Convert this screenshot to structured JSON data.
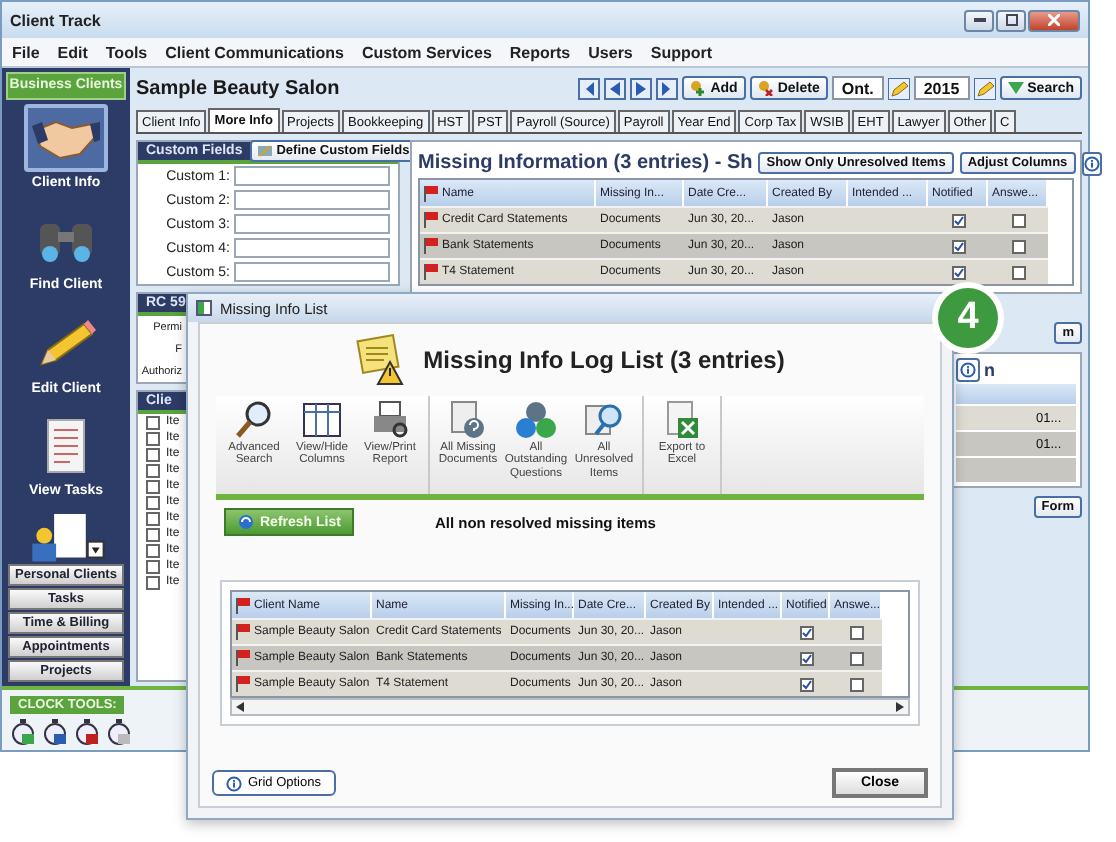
{
  "main_window": {
    "title": "Client Track",
    "menu": [
      "File",
      "Edit",
      "Tools",
      "Client Communications",
      "Custom Services",
      "Reports",
      "Users",
      "Support"
    ],
    "sidebar": {
      "header": "Business Clients",
      "tools": [
        {
          "label": "Client Info",
          "kind": "handshake",
          "selected": true
        },
        {
          "label": "Find Client",
          "kind": "binoculars",
          "selected": false
        },
        {
          "label": "Edit Client",
          "kind": "pencil",
          "selected": false
        },
        {
          "label": "View Tasks",
          "kind": "tasks",
          "selected": false
        }
      ],
      "nav": [
        "Personal Clients",
        "Tasks",
        "Time & Billing",
        "Appointments",
        "Projects"
      ]
    },
    "client_name": "Sample Beauty Salon",
    "toolbar": {
      "add": "Add",
      "delete": "Delete",
      "province": "Ont.",
      "year": "2015",
      "search": "Search"
    },
    "tabs": [
      {
        "label": "Client Info",
        "selected": false
      },
      {
        "label": "More Info",
        "selected": true
      },
      {
        "label": "Projects",
        "selected": false
      },
      {
        "label": "Bookkeeping",
        "selected": false
      },
      {
        "label": "HST",
        "selected": false
      },
      {
        "label": "PST",
        "selected": false
      },
      {
        "label": "Payroll (Source)",
        "selected": false
      },
      {
        "label": "Payroll",
        "selected": false
      },
      {
        "label": "Year End",
        "selected": false
      },
      {
        "label": "Corp Tax",
        "selected": false
      },
      {
        "label": "WSIB",
        "selected": false
      },
      {
        "label": "EHT",
        "selected": false
      },
      {
        "label": "Lawyer",
        "selected": false
      },
      {
        "label": "Other",
        "selected": false
      },
      {
        "label": "C",
        "selected": false
      }
    ],
    "custom_fields": {
      "title": "Custom Fields",
      "define_button": "Define Custom Fields",
      "fields": [
        "Custom 1:",
        "Custom 2:",
        "Custom 3:",
        "Custom 4:",
        "Custom 5:"
      ]
    },
    "rc59": {
      "title": "RC 59",
      "labels": [
        "Permi",
        "F",
        "Authoriz"
      ]
    },
    "client_section": {
      "title": "Clie",
      "items": [
        {
          "label": "Ite",
          "checked": false
        },
        {
          "label": "Ite",
          "checked": false
        },
        {
          "label": "Ite",
          "checked": false
        },
        {
          "label": "Ite",
          "checked": false
        },
        {
          "label": "Ite",
          "checked": false
        },
        {
          "label": "Ite",
          "checked": false
        },
        {
          "label": "Ite",
          "checked": false
        },
        {
          "label": "Ite",
          "checked": false
        },
        {
          "label": "Ite",
          "checked": false
        },
        {
          "label": "Ite",
          "checked": false
        },
        {
          "label": "Ite",
          "checked": false
        }
      ]
    },
    "missing_info": {
      "title": "Missing Information (3 entries) - Sh",
      "show_unresolved_button": "Show Only Unresolved Items",
      "adjust_columns_button": "Adjust Columns",
      "columns": [
        "Name",
        "Missing In...",
        "Date Cre...",
        "Created By",
        "Intended ...",
        "Notified",
        "Answe..."
      ],
      "rows": [
        {
          "name": "Credit Card Statements",
          "missing_in": "Documents",
          "date": "Jun 30, 20...",
          "created_by": "Jason",
          "notified": true,
          "answered": false
        },
        {
          "name": "Bank Statements",
          "missing_in": "Documents",
          "date": "Jun 30, 20...",
          "created_by": "Jason",
          "notified": true,
          "answered": false
        },
        {
          "name": "T4 Statement",
          "missing_in": "Documents",
          "date": "Jun 30, 20...",
          "created_by": "Jason",
          "notified": true,
          "answered": false
        }
      ]
    },
    "side_strip": {
      "top_button": "m",
      "section_title": "n",
      "cells": [
        "01...",
        "01..."
      ],
      "form_button": "Form"
    },
    "clock_tools": {
      "title": "CLOCK TOOLS:"
    }
  },
  "dialog": {
    "title": "Missing Info List",
    "heading": "Missing Info Log List (3 entries)",
    "tool_groups": [
      [
        {
          "label": "Advanced Search",
          "kind": "search"
        },
        {
          "label": "View/Hide Columns",
          "kind": "columns"
        },
        {
          "label": "View/Print Report",
          "kind": "report"
        }
      ],
      [
        {
          "label": "All Missing Documents",
          "kind": "documents"
        },
        {
          "label": "All Outstanding Questions",
          "kind": "questions"
        },
        {
          "label": "All Unresolved Items",
          "kind": "unresolved"
        }
      ],
      [
        {
          "label": "Export to Excel",
          "kind": "excel"
        }
      ]
    ],
    "refresh_button": "Refresh List",
    "filter_label": "All non resolved missing items",
    "columns": [
      "Client Name",
      "Name",
      "Missing In...",
      "Date Cre...",
      "Created By",
      "Intended ...",
      "Notified",
      "Answe..."
    ],
    "rows": [
      {
        "client": "Sample Beauty Salon",
        "name": "Credit Card Statements",
        "missing_in": "Documents",
        "date": "Jun 30, 20...",
        "created_by": "Jason",
        "notified": true,
        "answered": false
      },
      {
        "client": "Sample Beauty Salon",
        "name": "Bank Statements",
        "missing_in": "Documents",
        "date": "Jun 30, 20...",
        "created_by": "Jason",
        "notified": true,
        "answered": false
      },
      {
        "client": "Sample Beauty Salon",
        "name": "T4 Statement",
        "missing_in": "Documents",
        "date": "Jun 30, 20...",
        "created_by": "Jason",
        "notified": true,
        "answered": false
      }
    ],
    "grid_options_button": "Grid Options",
    "close_button": "Close"
  },
  "step_badge": "4"
}
